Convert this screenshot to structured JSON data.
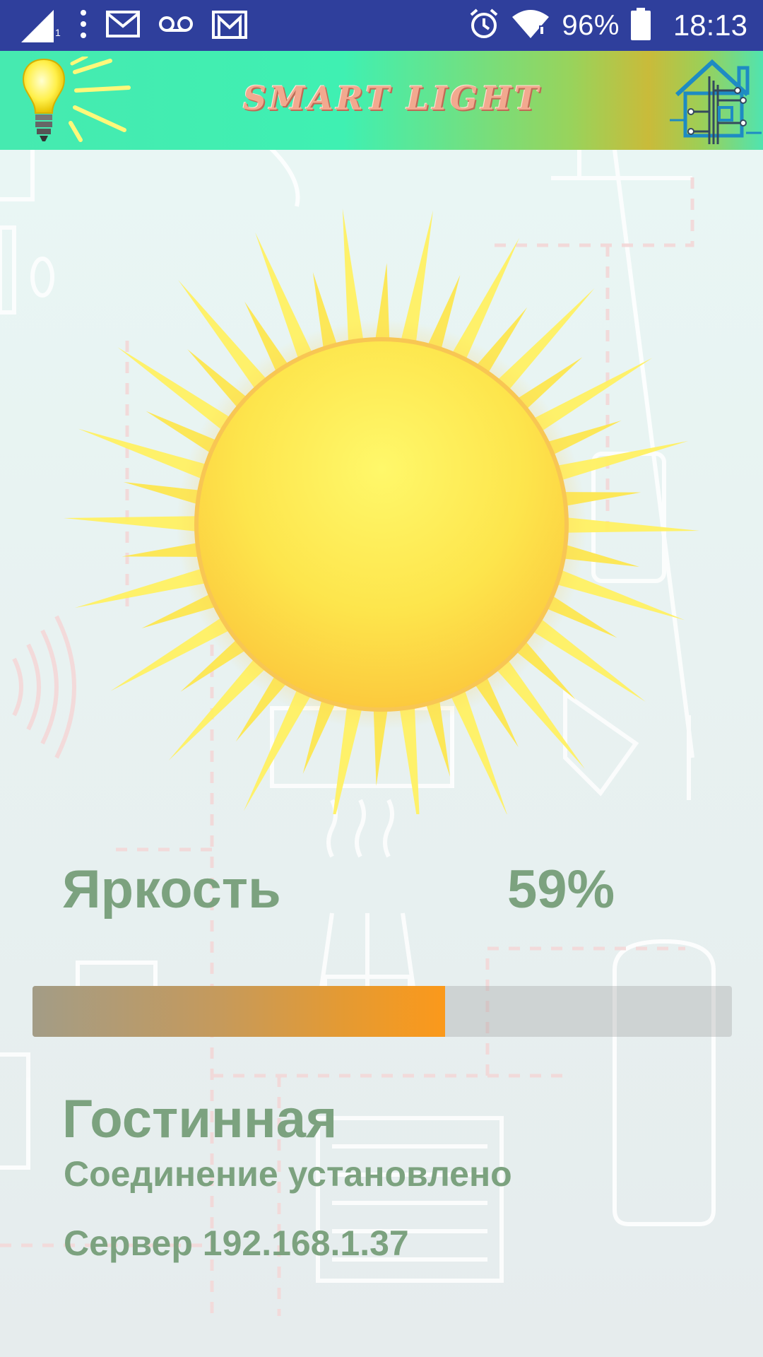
{
  "status_bar": {
    "sim_slot": "1",
    "battery": "96%",
    "time": "18:13",
    "icons": [
      "signal-icon",
      "more-icon",
      "mail-icon",
      "voicemail-icon",
      "gmail-icon",
      "alarm-icon",
      "wifi-icon",
      "battery-icon"
    ]
  },
  "app_bar": {
    "title": "SMART LIGHT",
    "icons": [
      "lightbulb-icon",
      "smart-home-icon"
    ]
  },
  "brightness": {
    "label": "Яркость",
    "value_text": "59%",
    "value": 59
  },
  "room": {
    "name": "Гостинная",
    "connection_status": "Соединение установлено",
    "server": "Сервер 192.168.1.37"
  },
  "colors": {
    "status_bar": "#2f3f9c",
    "text": "#7ca27f",
    "progress_start": "#a39c86",
    "progress_end": "#fb991b",
    "sun": "#fde85a"
  }
}
